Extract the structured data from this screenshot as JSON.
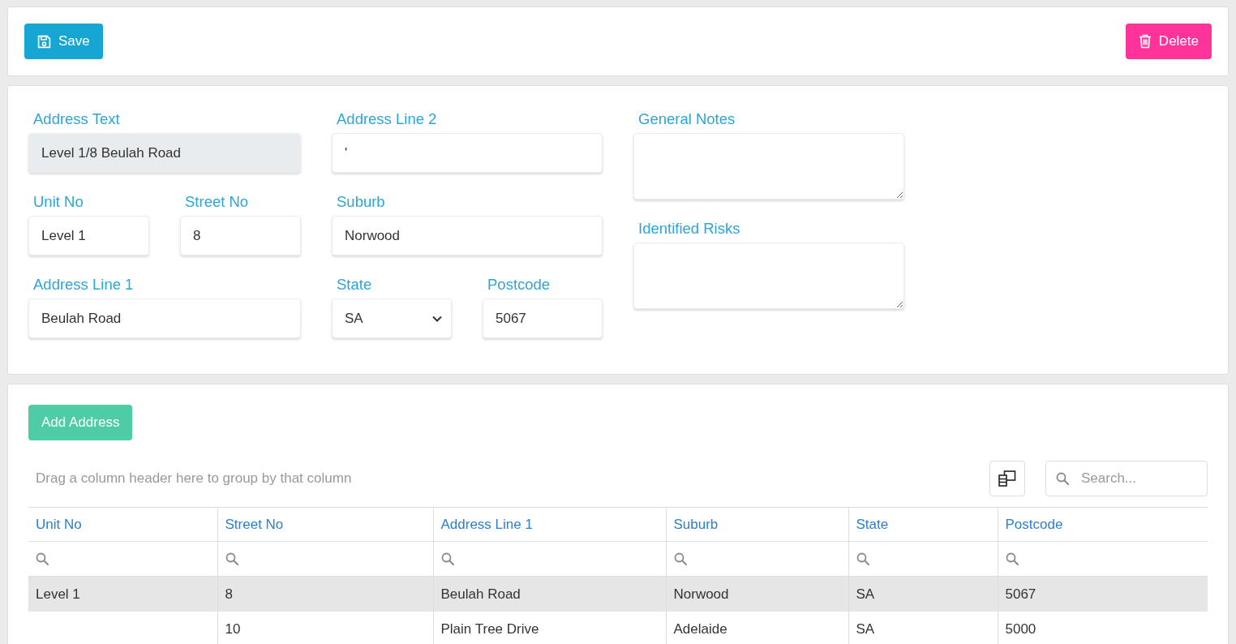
{
  "toolbar": {
    "buttons": [
      {
        "kind": "save",
        "label": "Save"
      },
      {
        "kind": "delete",
        "label": "Delete"
      }
    ]
  },
  "form": {
    "columns": [
      {
        "rows": [
          [
            {
              "kind": "readonly",
              "label": "Address Text",
              "value": "Level 1/8 Beulah Road"
            }
          ],
          [
            {
              "kind": "text",
              "label": "Unit No",
              "value": "Level 1"
            },
            {
              "kind": "text",
              "label": "Street No",
              "value": "8"
            }
          ],
          [
            {
              "kind": "text",
              "label": "Address Line 1",
              "value": "Beulah Road"
            }
          ]
        ]
      },
      {
        "rows": [
          [
            {
              "kind": "text",
              "label": "Address Line 2",
              "value": "'"
            }
          ],
          [
            {
              "kind": "text",
              "label": "Suburb",
              "value": "Norwood"
            }
          ],
          [
            {
              "kind": "select",
              "label": "State",
              "value": "SA"
            },
            {
              "kind": "text",
              "label": "Postcode",
              "value": "5067"
            }
          ]
        ]
      },
      {
        "rows": [
          [
            {
              "kind": "textarea",
              "label": "General Notes"
            }
          ],
          [
            {
              "kind": "textarea",
              "label": "Identified Risks"
            }
          ]
        ]
      }
    ]
  },
  "grid": {
    "add_button": "Add Address",
    "group_panel": "Drag a column header here to group by that column",
    "search": {
      "placeholder": "Search..."
    },
    "columns": [
      "Unit No",
      "Street No",
      "Address Line 1",
      "Suburb",
      "State",
      "Postcode"
    ],
    "rows": [
      {
        "selected": true,
        "cells": [
          "Level 1",
          "8",
          "Beulah Road",
          "Norwood",
          "SA",
          "5067"
        ]
      },
      {
        "selected": false,
        "cells": [
          null,
          "10",
          "Plain Tree Drive",
          "Adelaide",
          "SA",
          "5000"
        ]
      }
    ]
  }
}
